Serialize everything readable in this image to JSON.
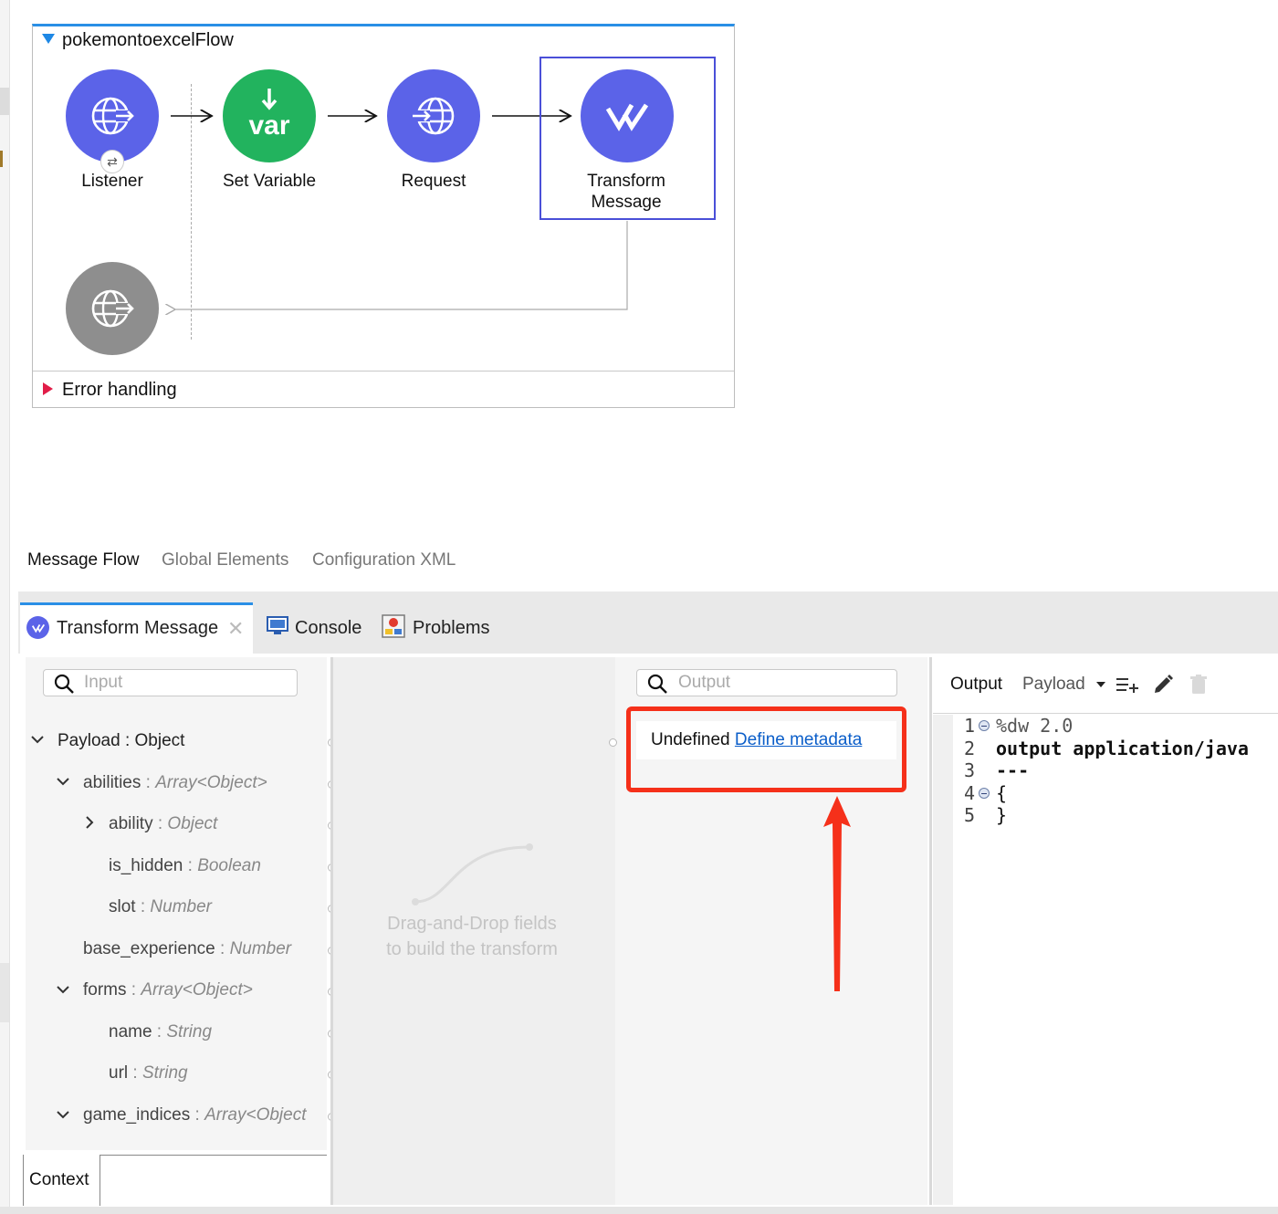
{
  "flow": {
    "name": "pokemontoexcelFlow",
    "nodes": [
      {
        "label": "Listener",
        "color": "#5b63e8"
      },
      {
        "label": "Set Variable",
        "color": "#22b35e",
        "icon_text": "var"
      },
      {
        "label": "Request",
        "color": "#5b63e8"
      },
      {
        "label": "Transform\nMessage",
        "color": "#5b63e8",
        "selected": true
      }
    ],
    "error_handling": "Error handling"
  },
  "editor_tabs": {
    "message_flow": "Message Flow",
    "global_elements": "Global Elements",
    "configuration_xml": "Configuration XML"
  },
  "views": {
    "transform_message": "Transform Message",
    "console": "Console",
    "problems": "Problems"
  },
  "input_panel": {
    "search_placeholder": "Input",
    "tree": [
      {
        "name": "Payload",
        "type": "Object"
      },
      {
        "name": "abilities",
        "type": "Array<Object>"
      },
      {
        "name": "ability",
        "type": "Object"
      },
      {
        "name": "is_hidden",
        "type": "Boolean"
      },
      {
        "name": "slot",
        "type": "Number"
      },
      {
        "name": "base_experience",
        "type": "Number"
      },
      {
        "name": "forms",
        "type": "Array<Object>"
      },
      {
        "name": "name",
        "type": "String"
      },
      {
        "name": "url",
        "type": "String"
      },
      {
        "name": "game_indices",
        "type": "Array<Object"
      }
    ],
    "context_tab": "Context",
    "separator": " : "
  },
  "mapping_panel": {
    "hint_line1": "Drag-and-Drop fields",
    "hint_line2": "to build the transform"
  },
  "output_panel": {
    "search_placeholder": "Output",
    "undefined_text": "Undefined",
    "define_link": "Define metadata"
  },
  "code_panel": {
    "output_label": "Output",
    "payload_selector": "Payload",
    "lines": [
      {
        "n": "1",
        "text": "%dw 2.0"
      },
      {
        "n": "2",
        "text": "output application/java"
      },
      {
        "n": "3",
        "text": "---"
      },
      {
        "n": "4",
        "text": "{"
      },
      {
        "n": "5",
        "text": "}"
      }
    ]
  },
  "colors": {
    "accent_blue": "#2a8fe6",
    "node_purple": "#5b63e8",
    "node_green": "#22b35e",
    "node_gray": "#8e8e8e",
    "annotation_red": "#f5301a"
  }
}
